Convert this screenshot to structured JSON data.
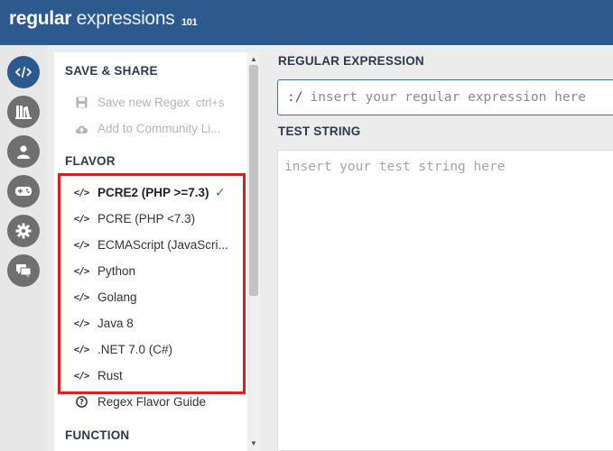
{
  "header": {
    "logo_word1": "regular",
    "logo_word2": "expressions",
    "logo_version": "101",
    "brand_color": "#2c5a8e"
  },
  "rail": {
    "items": [
      {
        "icon": "code-icon",
        "active": true
      },
      {
        "icon": "library-icon",
        "active": false
      },
      {
        "icon": "user-icon",
        "active": false
      },
      {
        "icon": "quiz-icon",
        "active": false
      },
      {
        "icon": "settings-icon",
        "active": false
      },
      {
        "icon": "chat-icon",
        "active": false
      }
    ]
  },
  "menu": {
    "save_share": {
      "title": "SAVE & SHARE",
      "items": [
        {
          "label": "Save new Regex",
          "shortcut": "ctrl+s",
          "icon": "save-icon"
        },
        {
          "label": "Add to Community Li...",
          "icon": "cloud-upload-icon"
        }
      ]
    },
    "flavor": {
      "title": "FLAVOR",
      "items": [
        {
          "label": "PCRE2 (PHP >=7.3)",
          "selected": true
        },
        {
          "label": "PCRE (PHP <7.3)"
        },
        {
          "label": "ECMAScript (JavaScri..."
        },
        {
          "label": "Python"
        },
        {
          "label": "Golang"
        },
        {
          "label": "Java 8"
        },
        {
          "label": ".NET 7.0 (C#)"
        },
        {
          "label": "Rust"
        }
      ],
      "guide_label": "Regex Flavor Guide",
      "code_icon_text": "</>",
      "check_mark": "✓"
    },
    "function": {
      "title": "FUNCTION"
    }
  },
  "main": {
    "regex_label": "REGULAR EXPRESSION",
    "regex_delim": ":/",
    "regex_placeholder": "insert your regular expression here",
    "test_label": "TEST STRING",
    "test_placeholder": "insert your test string here"
  },
  "highlight_color": "#d9201f"
}
